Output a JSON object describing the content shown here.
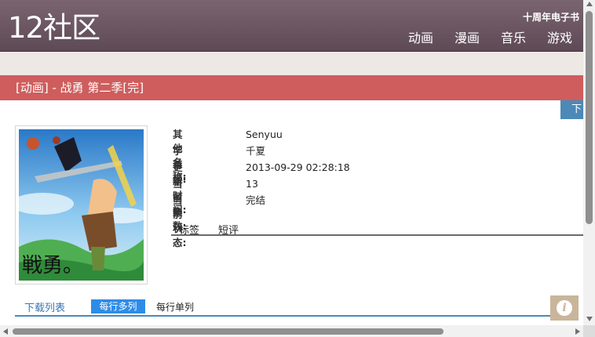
{
  "header": {
    "logo": "12社区",
    "top_link": "十周年电子书",
    "nav": [
      "动画",
      "漫画",
      "音乐",
      "游戏"
    ]
  },
  "page_title": "[动画] - 战勇 第二季[完]",
  "download_tab": "下",
  "info": {
    "rows": [
      {
        "label": "其他名称:",
        "value": "Senyuu"
      },
      {
        "label": "字幕组:",
        "value": "千夏"
      },
      {
        "label": "更新时间:",
        "value": "2013-09-29 02:28:18"
      },
      {
        "label": "当前集数:",
        "value": "13"
      },
      {
        "label": "当前状态:",
        "value": "完结"
      }
    ]
  },
  "tabs": [
    "标签",
    "短评"
  ],
  "list": {
    "title": "下载列表",
    "multi_label": "每行多列",
    "single_label": "每行单列"
  },
  "info_button": "i",
  "colors": {
    "header": "#6e5864",
    "title_bar": "#cf5d5d",
    "accent_blue": "#2d8ce8",
    "link_blue": "#3a77b0"
  }
}
